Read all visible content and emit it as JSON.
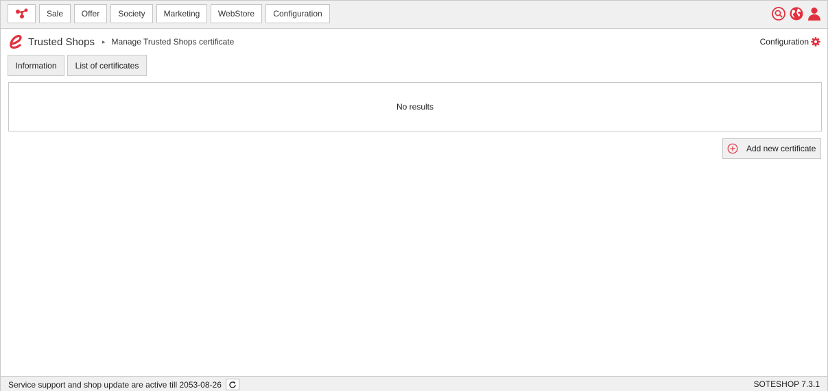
{
  "nav": {
    "logo_icon": "graph-nodes-icon",
    "items": [
      "Sale",
      "Offer",
      "Society",
      "Marketing",
      "WebStore",
      "Configuration"
    ],
    "right_icons": [
      "search-icon",
      "globe-icon",
      "user-icon"
    ]
  },
  "breadcrumb": {
    "app_icon": "trusted-shops-e-icon",
    "title": "Trusted Shops",
    "separator": "▸",
    "current": "Manage Trusted Shops certificate"
  },
  "config_link": {
    "label": "Configuration",
    "icon": "gear-icon"
  },
  "tabs": [
    "Information",
    "List of certificates"
  ],
  "results": {
    "message": "No results"
  },
  "actions": {
    "add_label": "Add new certificate",
    "add_icon": "plus-circle-icon"
  },
  "footer": {
    "status": "Service support and shop update are active till 2053-08-26",
    "refresh_icon": "refresh-icon",
    "version": "SOTESHOP 7.3.1"
  },
  "colors": {
    "accent": "#e0313f",
    "bar_bg": "#f0f0f0",
    "border": "#c8c8c8"
  }
}
